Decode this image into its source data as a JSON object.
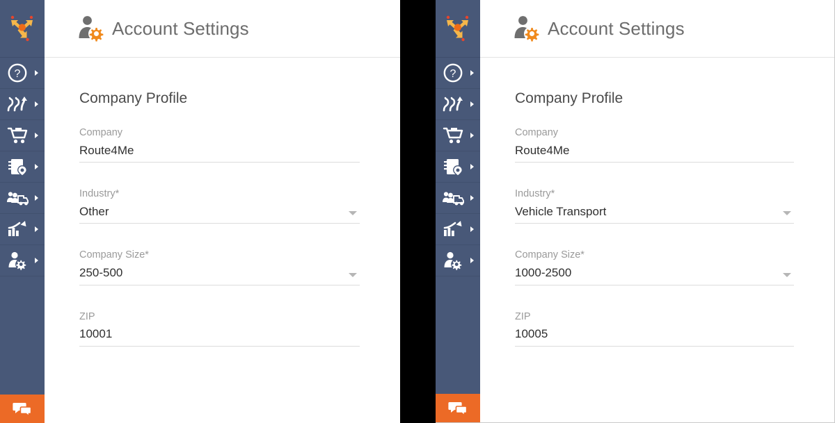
{
  "window": {
    "background_color": "#000000",
    "panel_background": "#ffffff",
    "sidebar_color": "#485878",
    "accent_color": "#ec6a26",
    "title_color": "#6d6d6d",
    "label_color": "#9a9a9a",
    "value_color": "#2f2f2f"
  },
  "sidebar": {
    "logo": {
      "name": "route4me-logo",
      "alt": "Route4Me"
    },
    "items": [
      {
        "icon": "help-circle-icon",
        "label": "Help",
        "has_submenu": true
      },
      {
        "icon": "routes-icon",
        "label": "Routes",
        "has_submenu": true
      },
      {
        "icon": "orders-cart-icon",
        "label": "Orders",
        "has_submenu": true
      },
      {
        "icon": "address-book-icon",
        "label": "Address Book",
        "has_submenu": true
      },
      {
        "icon": "customers-truck-icon",
        "label": "Customers",
        "has_submenu": true
      },
      {
        "icon": "analytics-chart-icon",
        "label": "Analytics",
        "has_submenu": true
      },
      {
        "icon": "account-settings-icon",
        "label": "Account Settings",
        "has_submenu": true
      }
    ],
    "chat": {
      "icon": "chat-bubble-icon",
      "label": "Chat"
    }
  },
  "panels": [
    {
      "id": "left",
      "header": {
        "icon": "account-settings-icon",
        "title": "Account Settings"
      },
      "section_title": "Company Profile",
      "fields": [
        {
          "label": "Company",
          "value": "Route4Me",
          "type": "text",
          "required": false
        },
        {
          "label": "Industry*",
          "value": "Other",
          "type": "select",
          "required": true
        },
        {
          "label": "Company Size*",
          "value": "250-500",
          "type": "select",
          "required": true
        },
        {
          "label": "ZIP",
          "value": "10001",
          "type": "text",
          "required": false
        }
      ]
    },
    {
      "id": "right",
      "header": {
        "icon": "account-settings-icon",
        "title": "Account Settings"
      },
      "section_title": "Company Profile",
      "fields": [
        {
          "label": "Company",
          "value": "Route4Me",
          "type": "text",
          "required": false
        },
        {
          "label": "Industry*",
          "value": "Vehicle Transport",
          "type": "select",
          "required": true
        },
        {
          "label": "Company Size*",
          "value": "1000-2500",
          "type": "select",
          "required": true
        },
        {
          "label": "ZIP",
          "value": "10005",
          "type": "text",
          "required": false
        }
      ]
    }
  ]
}
